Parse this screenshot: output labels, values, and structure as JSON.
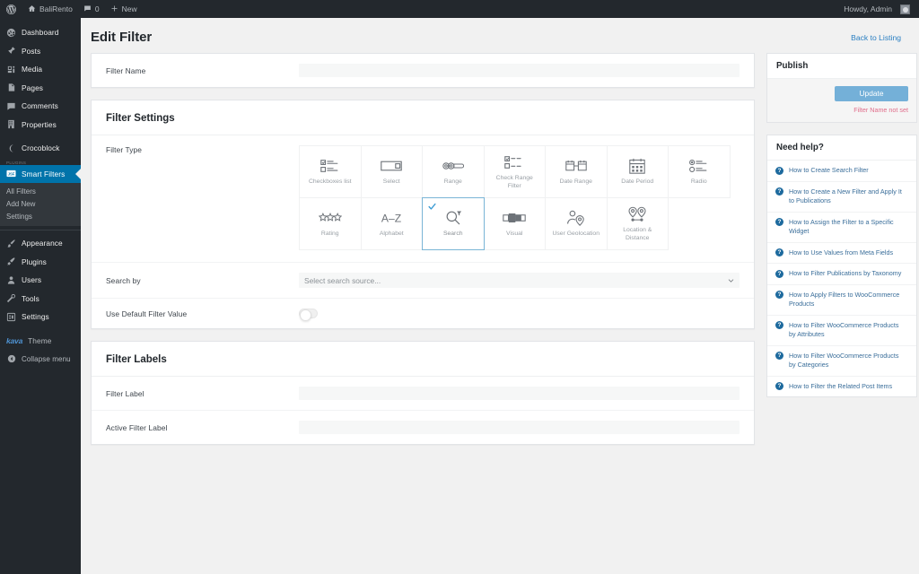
{
  "adminbar": {
    "wp_logo": "wordpress-logo",
    "site_name": "BaliRento",
    "comments_count": "0",
    "new_label": "New",
    "howdy": "Howdy, Admin"
  },
  "sidebar": {
    "items": [
      {
        "label": "Dashboard",
        "icon": "dashboard-icon"
      },
      {
        "label": "Posts",
        "icon": "pin-icon"
      },
      {
        "label": "Media",
        "icon": "media-icon"
      },
      {
        "label": "Pages",
        "icon": "page-icon"
      },
      {
        "label": "Comments",
        "icon": "comment-icon"
      },
      {
        "label": "Properties",
        "icon": "building-icon"
      },
      {
        "label": "Crocoblock",
        "icon": "crocoblock-icon"
      }
    ],
    "plugins_group_label": "PLUGINS",
    "current_item": {
      "label": "Smart Filters",
      "icon": "smart-filters-icon"
    },
    "submenu": [
      {
        "label": "All Filters",
        "current": false
      },
      {
        "label": "Add New",
        "current": false
      },
      {
        "label": "Settings",
        "current": false
      }
    ],
    "lower_items": [
      {
        "label": "Appearance",
        "icon": "brush-icon"
      },
      {
        "label": "Plugins",
        "icon": "plugin-icon"
      },
      {
        "label": "Users",
        "icon": "user-icon"
      },
      {
        "label": "Tools",
        "icon": "tools-icon"
      },
      {
        "label": "Settings",
        "icon": "settings-icon"
      }
    ],
    "theme": {
      "logo_text": "kava",
      "label": "Theme"
    },
    "collapse": {
      "label": "Collapse menu",
      "icon": "collapse-icon"
    }
  },
  "header": {
    "title": "Edit Filter",
    "back_link": "Back to Listing"
  },
  "filter_name_panel": {
    "label": "Filter Name",
    "value": "",
    "placeholder": ""
  },
  "filter_settings": {
    "title": "Filter Settings",
    "filter_type_label": "Filter Type",
    "types": [
      {
        "label": "Checkboxes list",
        "icon": "checkboxes-list-icon",
        "selected": false
      },
      {
        "label": "Select",
        "icon": "select-icon",
        "selected": false
      },
      {
        "label": "Range",
        "icon": "range-icon",
        "selected": false
      },
      {
        "label": "Check Range Filter",
        "icon": "check-range-filter-icon",
        "selected": false
      },
      {
        "label": "Date Range",
        "icon": "date-range-icon",
        "selected": false
      },
      {
        "label": "Date Period",
        "icon": "date-period-icon",
        "selected": false
      },
      {
        "label": "Radio",
        "icon": "radio-icon",
        "selected": false
      },
      {
        "label": "Rating",
        "icon": "rating-icon",
        "selected": false
      },
      {
        "label": "Alphabet",
        "icon": "alphabet-icon",
        "selected": false
      },
      {
        "label": "Search",
        "icon": "search-icon",
        "selected": true
      },
      {
        "label": "Visual",
        "icon": "visual-icon",
        "selected": false
      },
      {
        "label": "User Geolocation",
        "icon": "user-geolocation-icon",
        "selected": false
      },
      {
        "label": "Location & Distance",
        "icon": "location-distance-icon",
        "selected": false
      }
    ],
    "search_by": {
      "label": "Search by",
      "value": "Select search source...",
      "placeholder": "Select search source..."
    },
    "default_value": {
      "label": "Use Default Filter Value",
      "enabled": false
    }
  },
  "filter_labels_panel": {
    "title": "Filter Labels",
    "filter_label": {
      "label": "Filter Label",
      "value": ""
    },
    "active_filter_label": {
      "label": "Active Filter Label",
      "value": ""
    }
  },
  "publish": {
    "title": "Publish",
    "update_label": "Update",
    "note": "Filter Name not set",
    "accent_color": "#74b0d8",
    "note_color": "#e06c8a"
  },
  "help": {
    "title": "Need help?",
    "links": [
      "How to Create Search Filter",
      "How to Create a New Filter and Apply It to Publications",
      "How to Assign the Filter to a Specific Widget",
      "How to Use Values from Meta Fields",
      "How to Filter Publications by Taxonomy",
      "How to Apply Filters to WooCommerce Products",
      "How to Filter WooCommerce Products by Attributes",
      "How to Filter WooCommerce Products by Categories",
      "How to Filter the Related Post Items"
    ],
    "icon": "question-mark-icon",
    "link_color": "#3a6e9a"
  }
}
